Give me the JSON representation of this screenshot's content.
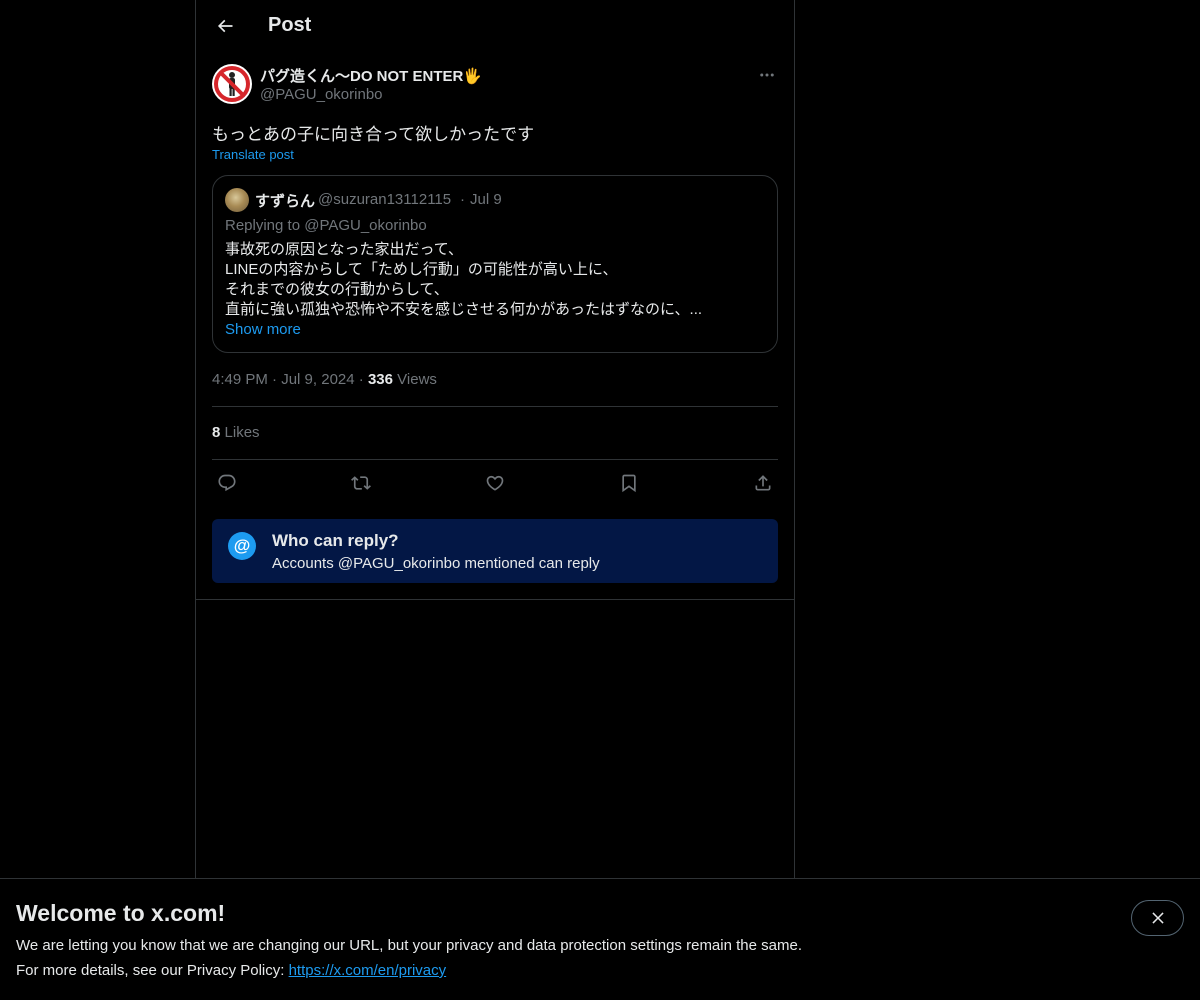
{
  "header": {
    "title": "Post"
  },
  "post": {
    "author_name": "パグ造くん〜DO NOT ENTER🖐",
    "author_handle": "@PAGU_okorinbo",
    "text": "もっとあの子に向き合って欲しかったです",
    "translate_label": "Translate post",
    "time": "4:49 PM",
    "date": "Jul 9, 2024",
    "views_count": "336",
    "views_label": "Views",
    "likes_count": "8",
    "likes_label": "Likes"
  },
  "quote": {
    "name": "すずらん",
    "handle": "@suzuran13112115",
    "dot": "·",
    "date": "Jul 9",
    "replying_to": "Replying to @PAGU_okorinbo",
    "lines": [
      "事故死の原因となった家出だって、",
      "LINEの内容からして「ためし行動」の可能性が高い上に、",
      "それまでの彼女の行動からして、",
      "直前に強い孤独や恐怖や不安を感じさせる何かがあったはずなのに、..."
    ],
    "show_more": "Show more"
  },
  "who_can_reply": {
    "title": "Who can reply?",
    "subtitle": "Accounts @PAGU_okorinbo mentioned can reply",
    "icon": "@"
  },
  "banner": {
    "title": "Welcome to x.com!",
    "line1": "We are letting you know that we are changing our URL, but your privacy and data protection settings remain the same.",
    "line2_prefix": "For more details, see our Privacy Policy: ",
    "link": "https://x.com/en/privacy"
  },
  "icons": [
    "back-arrow-icon",
    "more-icon",
    "reply-icon",
    "repost-icon",
    "like-icon",
    "bookmark-icon",
    "share-icon",
    "close-icon",
    "at-icon"
  ],
  "colors": {
    "accent": "#1d9bf0",
    "muted": "#71767b",
    "reply_box_bg": "#031745",
    "border": "#2f3336"
  }
}
